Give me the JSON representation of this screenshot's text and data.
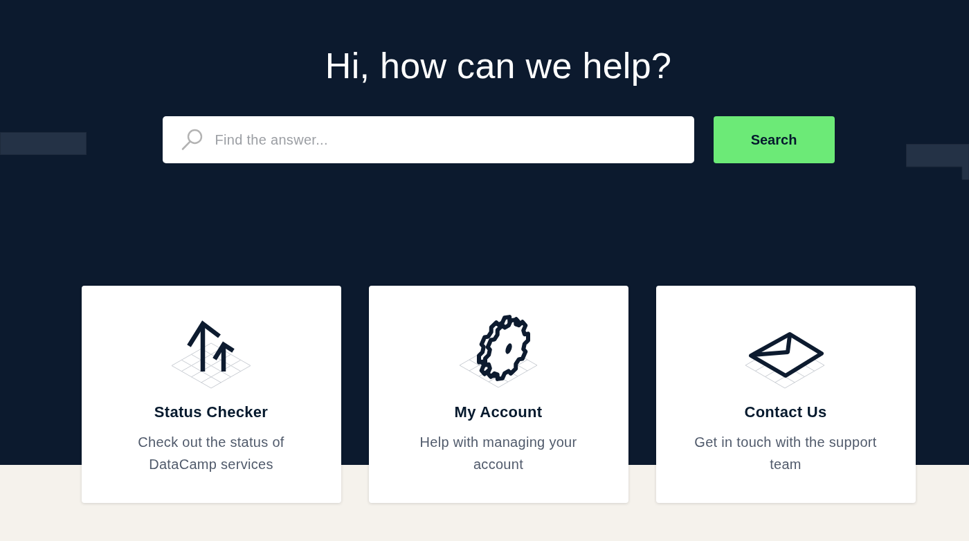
{
  "hero": {
    "heading": "Hi, how can we help?"
  },
  "search": {
    "placeholder": "Find the answer...",
    "button": "Search"
  },
  "cards": [
    {
      "kind": "arrows",
      "title": "Status Checker",
      "description": [
        "Check out the status of",
        "DataCamp services"
      ]
    },
    {
      "kind": "gear",
      "title": "My Account",
      "description": [
        "Help with managing your",
        "account"
      ]
    },
    {
      "kind": "envelope",
      "title": "Contact Us",
      "description": [
        "Get in touch with the support",
        "team"
      ]
    }
  ]
}
